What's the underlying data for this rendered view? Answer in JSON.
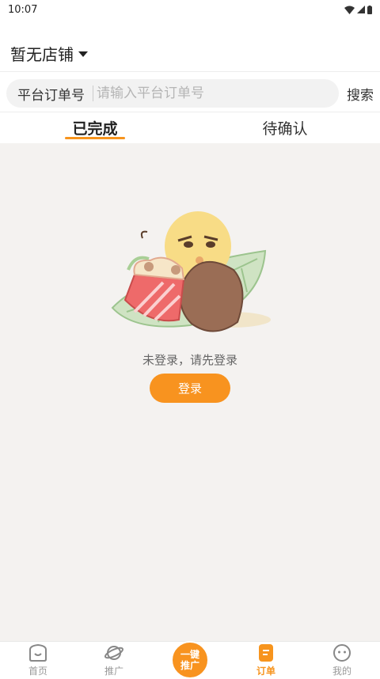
{
  "status_bar": {
    "time": "10:07"
  },
  "header": {
    "store_title": "暂无店铺"
  },
  "search": {
    "label": "平台订单号",
    "placeholder": "请输入平台订单号",
    "button_label": "搜索"
  },
  "tabs": [
    {
      "label": "已完成",
      "active": true
    },
    {
      "label": "待确认",
      "active": false
    }
  ],
  "empty_state": {
    "message": "未登录，请先登录",
    "login_label": "登录"
  },
  "bottom_nav": {
    "items": [
      {
        "label": "首页",
        "icon": "home-face-icon"
      },
      {
        "label": "推广",
        "icon": "planet-icon"
      },
      {
        "line1": "一键",
        "line2": "推广"
      },
      {
        "label": "订单",
        "icon": "order-icon",
        "active": true
      },
      {
        "label": "我的",
        "icon": "face-icon"
      }
    ]
  },
  "colors": {
    "accent": "#f8931f",
    "content_bg": "#f4f2f0"
  }
}
